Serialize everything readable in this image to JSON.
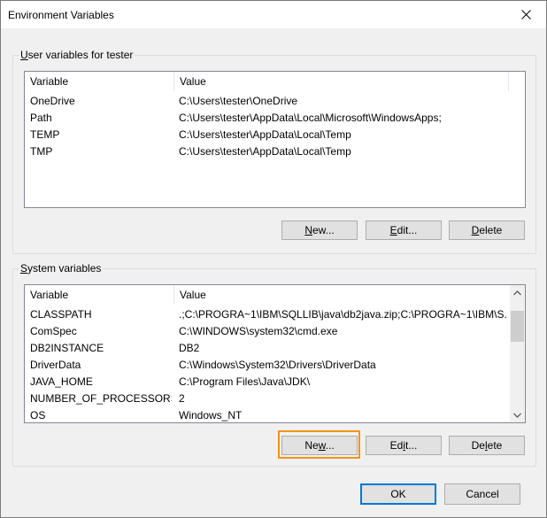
{
  "window": {
    "title": "Environment Variables"
  },
  "user_group": {
    "legend_pre": "",
    "legend_key": "U",
    "legend_post": "ser variables for tester",
    "columns": [
      "Variable",
      "Value"
    ],
    "rows": [
      {
        "variable": "OneDrive",
        "value": "C:\\Users\\tester\\OneDrive"
      },
      {
        "variable": "Path",
        "value": "C:\\Users\\tester\\AppData\\Local\\Microsoft\\WindowsApps;"
      },
      {
        "variable": "TEMP",
        "value": "C:\\Users\\tester\\AppData\\Local\\Temp"
      },
      {
        "variable": "TMP",
        "value": "C:\\Users\\tester\\AppData\\Local\\Temp"
      }
    ],
    "buttons": {
      "new": {
        "pre": "",
        "key": "N",
        "post": "ew..."
      },
      "edit": {
        "pre": "",
        "key": "E",
        "post": "dit..."
      },
      "delete": {
        "pre": "",
        "key": "D",
        "post": "elete"
      }
    }
  },
  "system_group": {
    "legend_pre": "",
    "legend_key": "S",
    "legend_post": "ystem variables",
    "columns": [
      "Variable",
      "Value"
    ],
    "rows": [
      {
        "variable": "CLASSPATH",
        "value": ".;C:\\PROGRA~1\\IBM\\SQLLIB\\java\\db2java.zip;C:\\PROGRA~1\\IBM\\S..."
      },
      {
        "variable": "ComSpec",
        "value": "C:\\WINDOWS\\system32\\cmd.exe"
      },
      {
        "variable": "DB2INSTANCE",
        "value": "DB2"
      },
      {
        "variable": "DriverData",
        "value": "C:\\Windows\\System32\\Drivers\\DriverData"
      },
      {
        "variable": "JAVA_HOME",
        "value": "C:\\Program Files\\Java\\JDK\\"
      },
      {
        "variable": "NUMBER_OF_PROCESSORS",
        "value": "2"
      },
      {
        "variable": "OS",
        "value": "Windows_NT"
      }
    ],
    "scroll_position": 0,
    "buttons": {
      "new": {
        "pre": "Ne",
        "key": "w",
        "post": "..."
      },
      "edit": {
        "pre": "Ed",
        "key": "i",
        "post": "t..."
      },
      "delete": {
        "pre": "De",
        "key": "l",
        "post": "ete"
      }
    }
  },
  "footer": {
    "ok": "OK",
    "cancel": "Cancel"
  },
  "colors": {
    "highlight": "#f29417",
    "default_button": "#0078d7"
  }
}
